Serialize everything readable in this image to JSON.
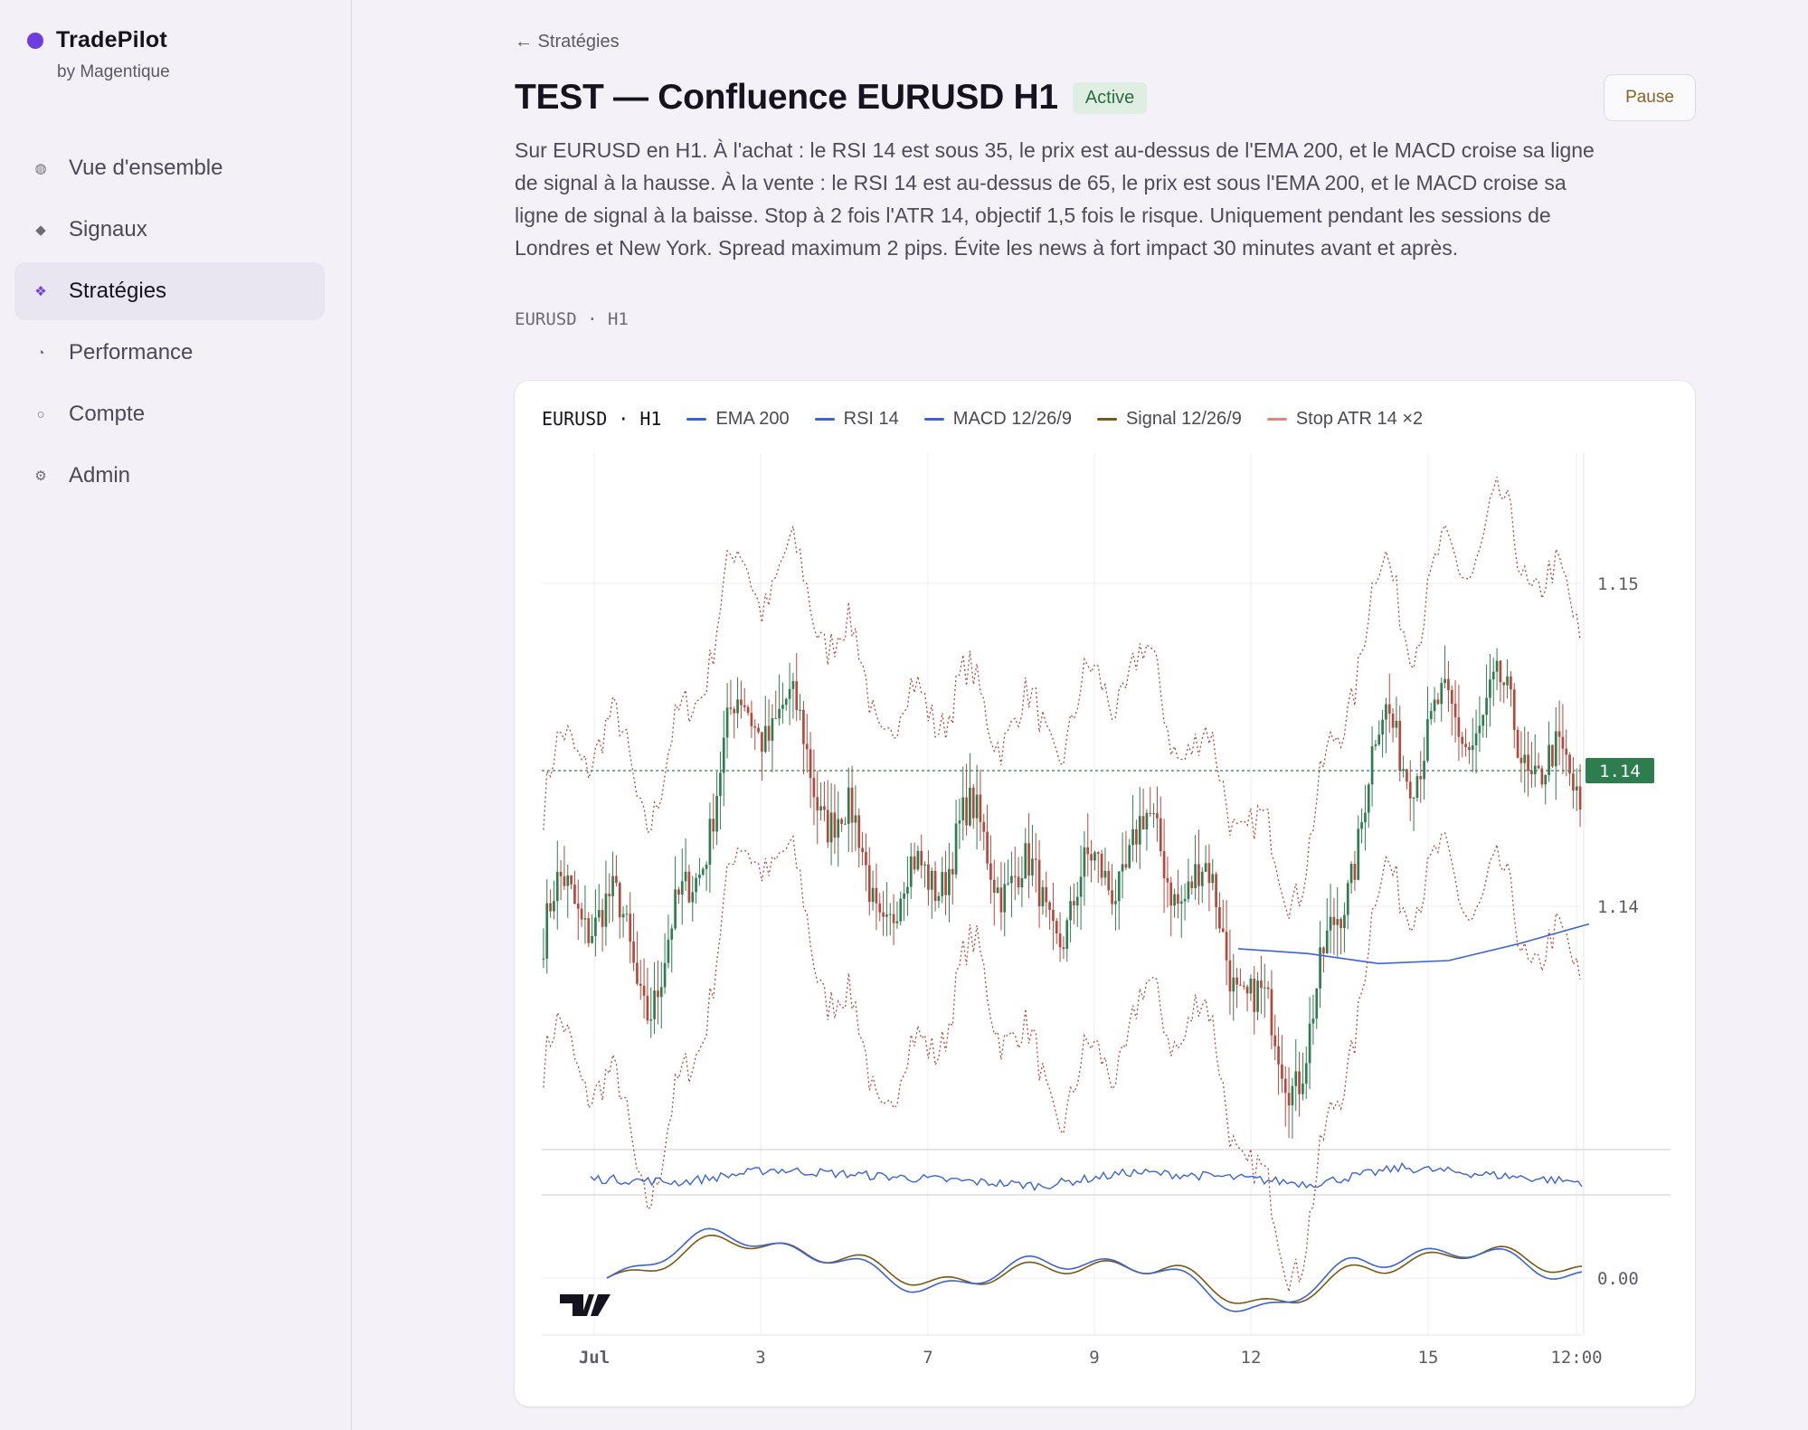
{
  "app": {
    "name": "TradePilot",
    "subtitle": "by Magentique",
    "brand_color": "#6d3de0"
  },
  "sidebar": {
    "items": [
      {
        "label": "Vue d'ensemble",
        "icon": "globe-icon",
        "glyph": "◍",
        "active": false
      },
      {
        "label": "Signaux",
        "icon": "diamond-icon",
        "glyph": "◆",
        "active": false
      },
      {
        "label": "Stratégies",
        "icon": "diamonds-cluster-icon",
        "glyph": "❖",
        "active": true
      },
      {
        "label": "Performance",
        "icon": "pie-chart-icon",
        "glyph": "◔",
        "active": false
      },
      {
        "label": "Compte",
        "icon": "circle-icon",
        "glyph": "○",
        "active": false
      },
      {
        "label": "Admin",
        "icon": "gear-icon",
        "glyph": "⚙",
        "active": false
      }
    ]
  },
  "page": {
    "back_label": "← Stratégies",
    "title": "TEST — Confluence EURUSD H1",
    "status_badge": "Active",
    "pause_label": "Pause",
    "description": "Sur EURUSD en H1. À l'achat : le RSI 14 est sous 35, le prix est au-dessus de l'EMA 200, et le MACD croise sa ligne de signal à la hausse. À la vente : le RSI 14 est au-dessus de 65, le prix est sous l'EMA 200, et le MACD croise sa ligne de signal à la baisse. Stop à 2 fois l'ATR 14, objectif 1,5 fois le risque. Uniquement pendant les sessions de Londres et New York. Spread maximum 2 pips. Évite les news à fort impact 30 minutes avant et après.",
    "meta": "EURUSD · H1"
  },
  "chart": {
    "symbol_label": "EURUSD · H1",
    "legend": [
      {
        "name": "EMA 200",
        "color": "#3a63d8"
      },
      {
        "name": "RSI 14",
        "color": "#3a63d8"
      },
      {
        "name": "MACD 12/26/9",
        "color": "#3a63d8"
      },
      {
        "name": "Signal 12/26/9",
        "color": "#7a5a12"
      },
      {
        "name": "Stop ATR 14 ×2",
        "color": "#e0877b"
      }
    ],
    "price_tag": "1.14",
    "up_color": "#2e7d4f",
    "down_color": "#b5483a",
    "stop_color": "#b5483a"
  },
  "chart_data": {
    "type": "line",
    "title": "",
    "x": [
      "Jul",
      "3",
      "7",
      "9",
      "12",
      "15",
      "12:00"
    ],
    "y_ticks": [
      "1.15",
      "1.14",
      "0.00"
    ],
    "series": [
      {
        "name": "EMA 200",
        "values": [
          1.1415,
          1.14145,
          1.14135,
          1.14138,
          1.14155,
          1.14175
        ]
      },
      {
        "name": "RSI 14",
        "values": [
          48,
          44,
          58,
          52,
          46,
          40,
          55,
          50,
          42,
          60,
          52,
          44
        ]
      },
      {
        "name": "MACD 12/26/9",
        "values": [
          0,
          0.0008,
          0.0004,
          -0.0002,
          0.0003,
          0.0002,
          -0.0006,
          0.0003,
          0.0005,
          0
        ]
      },
      {
        "name": "Signal 12/26/9",
        "values": [
          0,
          0.0007,
          0.0004,
          -0.0001,
          0.0002,
          0.0002,
          -0.0005,
          0.0002,
          0.0005,
          0.0001
        ]
      }
    ],
    "price_approx": [
      1.1416,
      1.1412,
      1.1438,
      1.1428,
      1.1425,
      1.1418,
      1.1428,
      1.1415,
      1.141,
      1.143,
      1.1445,
      1.1425
    ],
    "last_price": "1.14",
    "ylim": [
      1.1395,
      1.1465
    ],
    "grid": true,
    "legend": "top-left"
  }
}
